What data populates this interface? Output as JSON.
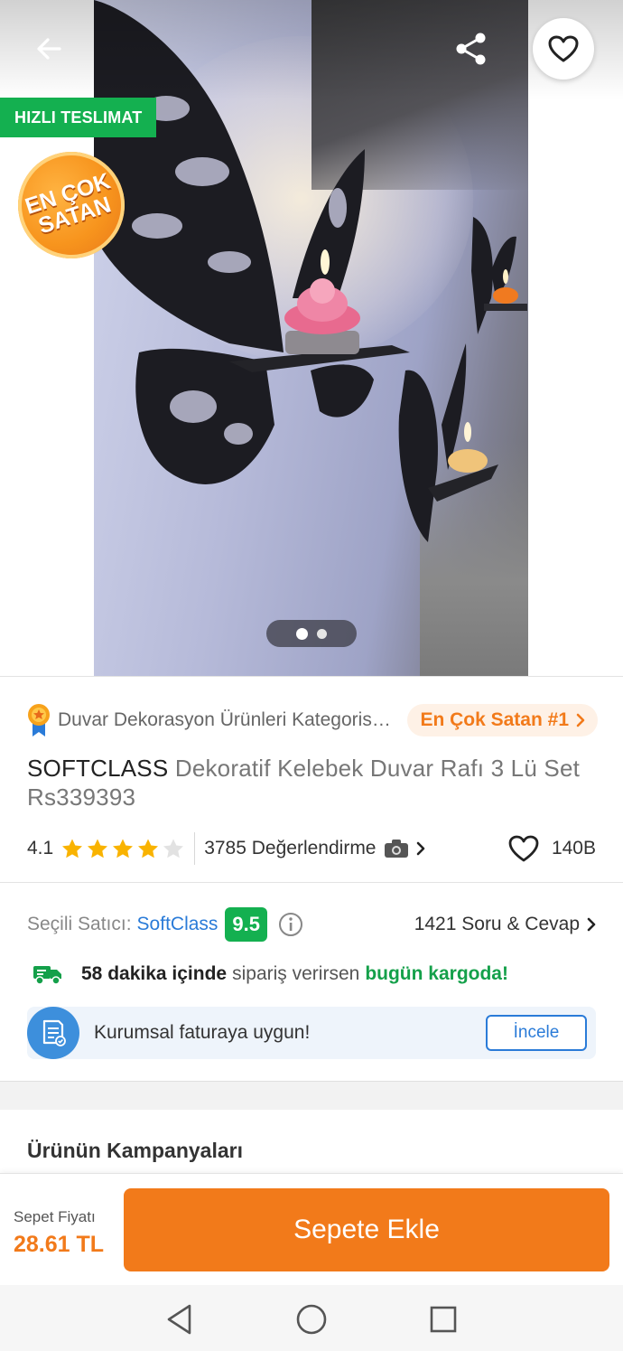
{
  "badges": {
    "fast_delivery": "HIZLI TESLIMAT",
    "best_seller_seal_line1": "EN ÇOK",
    "best_seller_seal_line2": "SATAN"
  },
  "gallery": {
    "image_count": 2,
    "active_index": 0
  },
  "product": {
    "category_text": "Duvar Dekorasyon Ürünleri Kategorisinde",
    "best_seller_rank": "En Çok Satan #1",
    "brand": "SOFTCLASS",
    "name": "Dekoratif Kelebek Duvar Rafı 3 Lü Set Rs339393",
    "rating": "4.1",
    "rating_value": 4.1,
    "reviews": "3785 Değerlendirme",
    "favorites": "140B"
  },
  "seller": {
    "label": "Seçili Satıcı:",
    "name": "SoftClass",
    "score": "9.5",
    "qa_link": "1421 Soru & Cevap"
  },
  "shipping": {
    "time_bold": "58 dakika içinde",
    "middle": "sipariş verirsen",
    "highlight": "bugün kargoda!"
  },
  "corporate": {
    "text": "Kurumsal faturaya uygun!",
    "button": "İncele"
  },
  "campaigns": {
    "title": "Ürünün Kampanyaları"
  },
  "cart": {
    "price_label": "Sepet Fiyatı",
    "price": "28.61 TL",
    "add_button": "Sepete Ekle"
  },
  "colors": {
    "accent": "#f27a1a",
    "green": "#14b050",
    "link_blue": "#2a7bd8",
    "star": "#f9b300"
  }
}
